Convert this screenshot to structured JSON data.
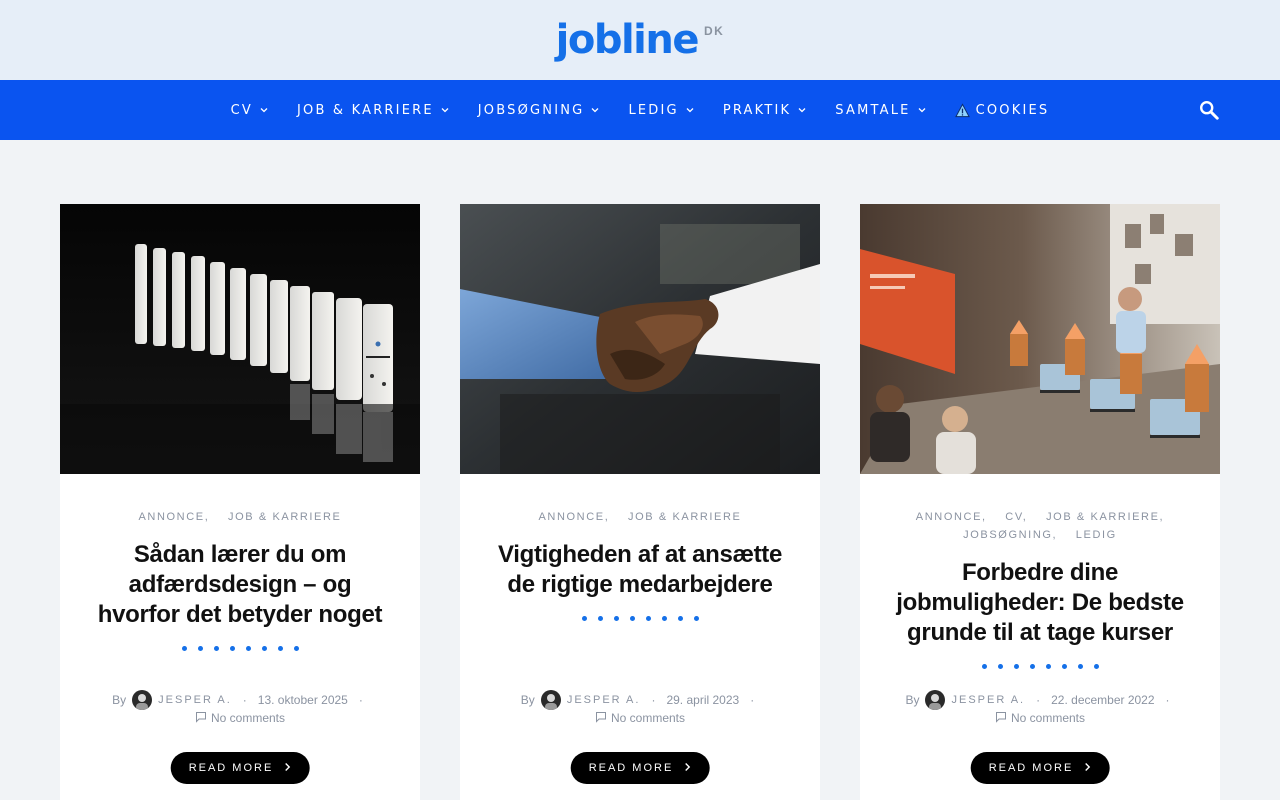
{
  "site": {
    "logo": "jobline",
    "tld": "DK"
  },
  "nav": {
    "items": [
      {
        "label": "CV"
      },
      {
        "label": "JOB & KARRIERE"
      },
      {
        "label": "JOBSØGNING"
      },
      {
        "label": "LEDIG"
      },
      {
        "label": "PRAKTIK"
      },
      {
        "label": "SAMTALE"
      },
      {
        "label": "COOKIES"
      }
    ],
    "icons": {
      "chevron": "chevron-down-icon",
      "cookie": "warning-triangle-icon",
      "search": "search-icon"
    }
  },
  "posts": [
    {
      "image": "dominoes-photo",
      "categories": [
        "ANNONCE",
        "JOB & KARRIERE"
      ],
      "title_bold": "",
      "title": "Sådan lærer du om adfærdsdesign – og hvorfor det betyder noget",
      "by": "By",
      "author": "JESPER A.",
      "date": "13. oktober 2025",
      "comments": "No comments",
      "button": "READ MORE"
    },
    {
      "image": "handshake-photo",
      "categories": [
        "ANNONCE",
        "JOB & KARRIERE"
      ],
      "title_bold": "",
      "title": "Vigtigheden af at ansætte de rigtige medarbejdere",
      "by": "By",
      "author": "JESPER A.",
      "date": "29. april 2023",
      "comments": "No comments",
      "button": "READ MORE"
    },
    {
      "image": "classroom-photo",
      "categories": [
        "ANNONCE",
        "CV",
        "JOB & KARRIERE",
        "JOBSØGNING",
        "LEDIG"
      ],
      "title_bold": "Forbedre dine jobmuligheder:",
      "title": " De bedste grunde til at tage kurser",
      "by": "By",
      "author": "JESPER A.",
      "date": "22. december 2022",
      "comments": "No comments",
      "button": "READ MORE"
    }
  ],
  "colors": {
    "accent": "#1570e8",
    "nav": "#0a54f0",
    "topbar": "#e6eef8",
    "page": "#f1f3f6"
  }
}
